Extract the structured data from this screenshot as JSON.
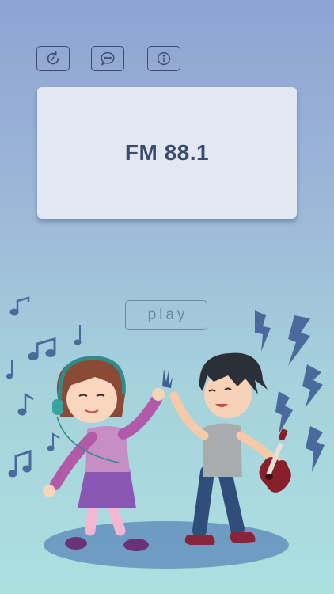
{
  "toolbar": {
    "buttons": [
      {
        "icon": "refresh-icon"
      },
      {
        "icon": "chat-icon"
      },
      {
        "icon": "info-icon"
      }
    ]
  },
  "station": {
    "label": "FM 88.1"
  },
  "controls": {
    "play_label": "play"
  },
  "illustration": {
    "subject": "music-kids-high-five"
  },
  "colors": {
    "accent": "#3e4c72",
    "panel": "#e2e7f1",
    "text": "#3a4c6c",
    "play_border": "#6f8aa8"
  }
}
